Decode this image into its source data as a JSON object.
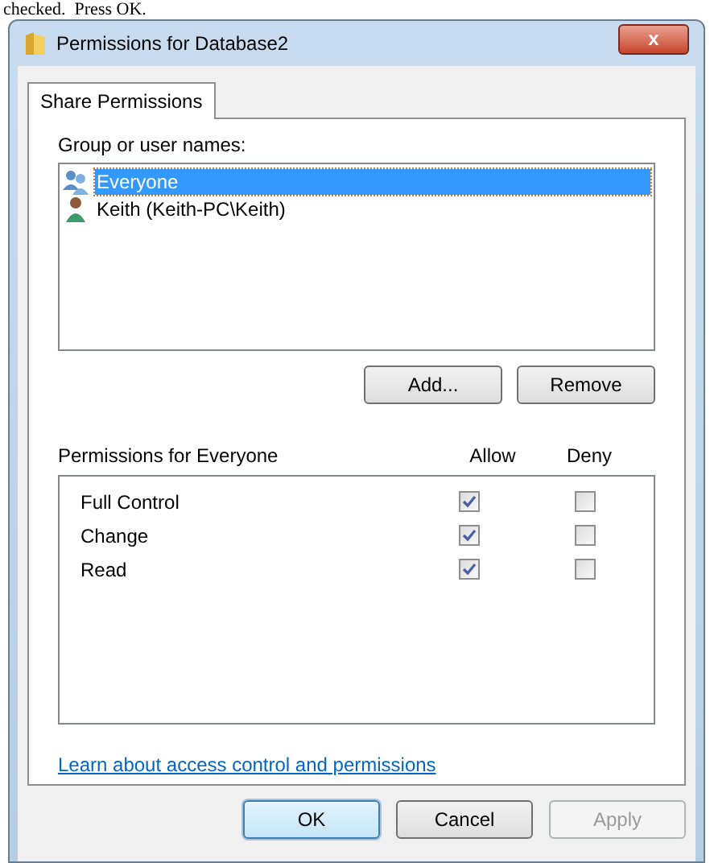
{
  "document_text": "checked.  Press OK.",
  "window": {
    "title": "Permissions for Database2",
    "close": "x"
  },
  "tabs": [
    {
      "label": "Share Permissions",
      "selected": true
    }
  ],
  "users_label": "Group or user names:",
  "users": [
    {
      "name": "Everyone",
      "kind": "group",
      "selected": true
    },
    {
      "name": "Keith (Keith-PC\\Keith)",
      "kind": "user",
      "selected": false
    }
  ],
  "user_buttons": [
    {
      "label": "Add..."
    },
    {
      "label": "Remove"
    }
  ],
  "permissions": {
    "label": "Permissions for Everyone",
    "columns": [
      "Allow",
      "Deny"
    ],
    "rows": [
      {
        "name": "Full Control",
        "allow": true,
        "deny": false
      },
      {
        "name": "Change",
        "allow": true,
        "deny": false
      },
      {
        "name": "Read",
        "allow": true,
        "deny": false
      }
    ]
  },
  "link": "Learn about access control and permissions",
  "buttons": [
    {
      "label": "OK",
      "default": true,
      "disabled": false
    },
    {
      "label": "Cancel",
      "default": false,
      "disabled": false
    },
    {
      "label": "Apply",
      "default": false,
      "disabled": true
    }
  ]
}
